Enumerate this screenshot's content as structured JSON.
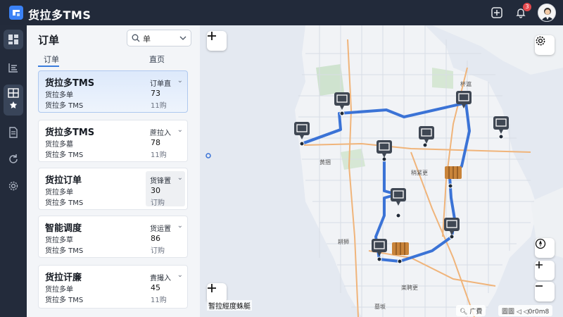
{
  "app": {
    "title": "货拉多TMS",
    "notification_count": "3"
  },
  "rail": {
    "items": [
      "dashboard-icon",
      "list-icon",
      "grid-star-icon",
      "document-icon",
      "refresh-icon",
      "settings-icon"
    ]
  },
  "panel": {
    "title": "订单",
    "search_text": "单",
    "tabs": [
      "订单",
      "直页"
    ],
    "cards": [
      {
        "title": "货拉多TMS",
        "line1": "货拉多单",
        "line2": "货拉多 TMS",
        "status": "订单直",
        "value1": "73",
        "value2": "11购"
      },
      {
        "title": "货拉多TMS",
        "line1": "货拉多墓",
        "line2": "货拉多 TMS",
        "status": "蔗拉入",
        "value1": "78",
        "value2": "11购"
      },
      {
        "title": "货拉订单",
        "line1": "货拉多单",
        "line2": "货拉多 TMS",
        "status": "货锋置",
        "value1": "30",
        "value2": "订购"
      },
      {
        "title": "智能调度",
        "line1": "货拉多草",
        "line2": "货拉多 TMS",
        "status": "货运置",
        "value1": "86",
        "value2": "订购"
      },
      {
        "title": "货拉讦廉",
        "line1": "货拉多单",
        "line2": "货拉多 TMS",
        "status": "責撮入",
        "value1": "45",
        "value2": "11购"
      }
    ]
  },
  "map": {
    "add_route_label": "暂拉經度蛛艇",
    "search_label": "广費",
    "attrib_label": "圖圖 ◁ ◁0r0m8",
    "place_labels": [
      "黄捆",
      "稍紧更",
      "耕狮",
      "楽聘更",
      "墓坂",
      "杯滬"
    ],
    "route_color": "#3b73d6"
  }
}
